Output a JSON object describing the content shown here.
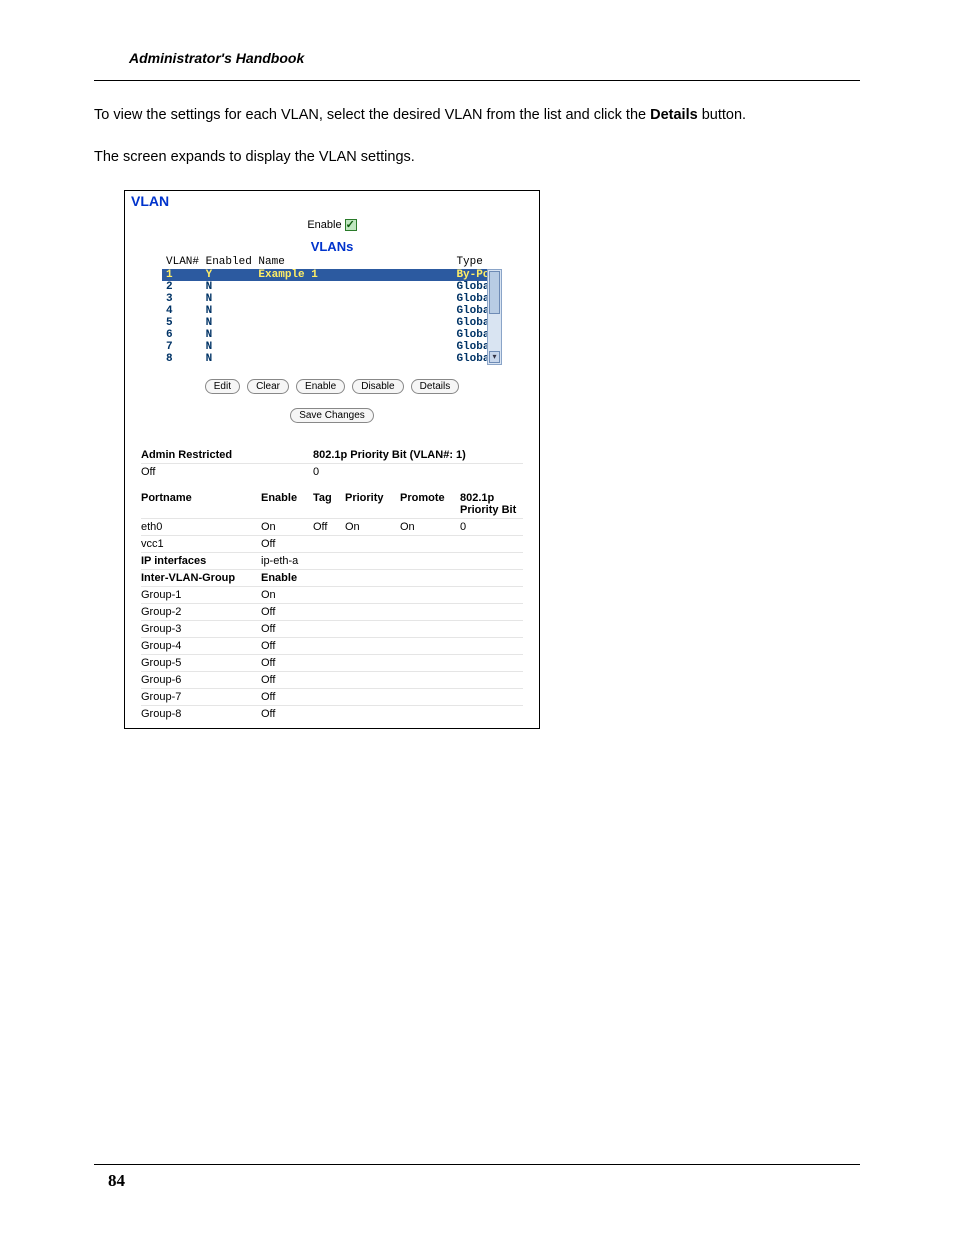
{
  "doc": {
    "running_head": "Administrator's Handbook",
    "p1_a": "To view the settings for each VLAN, select the desired VLAN from the list and click the ",
    "p1_b": "Details",
    "p1_c": " button.",
    "p2": "The screen expands to display the VLAN settings.",
    "page_number": "84"
  },
  "panel": {
    "title": "VLAN",
    "enable_label": "Enable",
    "subtitle": "VLANs",
    "col_vlan": "VLAN#",
    "col_enabled": "Enabled",
    "col_name": "Name",
    "col_type": "Type",
    "rows": [
      {
        "n": "1",
        "en": "Y",
        "name": "Example 1",
        "type": "By-Port",
        "sel": true
      },
      {
        "n": "2",
        "en": "N",
        "name": "",
        "type": "Global",
        "sel": false
      },
      {
        "n": "3",
        "en": "N",
        "name": "",
        "type": "Global",
        "sel": false
      },
      {
        "n": "4",
        "en": "N",
        "name": "",
        "type": "Global",
        "sel": false
      },
      {
        "n": "5",
        "en": "N",
        "name": "",
        "type": "Global",
        "sel": false
      },
      {
        "n": "6",
        "en": "N",
        "name": "",
        "type": "Global",
        "sel": false
      },
      {
        "n": "7",
        "en": "N",
        "name": "",
        "type": "Global",
        "sel": false
      },
      {
        "n": "8",
        "en": "N",
        "name": "",
        "type": "Global",
        "sel": false
      }
    ],
    "btn_edit": "Edit",
    "btn_clear": "Clear",
    "btn_enable": "Enable",
    "btn_disable": "Disable",
    "btn_details": "Details",
    "btn_save": "Save Changes"
  },
  "details": {
    "admin_restricted_label": "Admin Restricted",
    "admin_restricted_value": "Off",
    "priority_bit_label": "802.1p Priority Bit (VLAN#: 1)",
    "priority_bit_value": "0",
    "h_portname": "Portname",
    "h_enable": "Enable",
    "h_tag": "Tag",
    "h_priority": "Priority",
    "h_promote": "Promote",
    "h_pbit": "802.1p Priority Bit",
    "ports": [
      {
        "name": "eth0",
        "enable": "On",
        "tag": "Off",
        "priority": "On",
        "promote": "On",
        "pbit": "0"
      },
      {
        "name": "vcc1",
        "enable": "Off",
        "tag": "",
        "priority": "",
        "promote": "",
        "pbit": ""
      }
    ],
    "ip_interfaces_label": "IP interfaces",
    "ip_interfaces_value": "ip-eth-a",
    "ivg_label": "Inter-VLAN-Group",
    "ivg_enable_h": "Enable",
    "groups": [
      {
        "name": "Group-1",
        "enable": "On"
      },
      {
        "name": "Group-2",
        "enable": "Off"
      },
      {
        "name": "Group-3",
        "enable": "Off"
      },
      {
        "name": "Group-4",
        "enable": "Off"
      },
      {
        "name": "Group-5",
        "enable": "Off"
      },
      {
        "name": "Group-6",
        "enable": "Off"
      },
      {
        "name": "Group-7",
        "enable": "Off"
      },
      {
        "name": "Group-8",
        "enable": "Off"
      }
    ]
  }
}
